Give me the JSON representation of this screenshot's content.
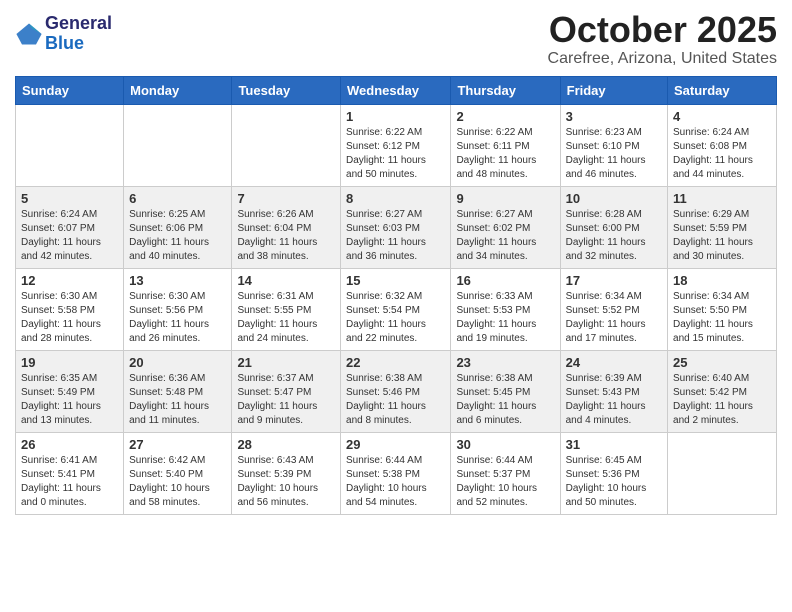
{
  "header": {
    "logo_general": "General",
    "logo_blue": "Blue",
    "title": "October 2025",
    "subtitle": "Carefree, Arizona, United States"
  },
  "weekdays": [
    "Sunday",
    "Monday",
    "Tuesday",
    "Wednesday",
    "Thursday",
    "Friday",
    "Saturday"
  ],
  "weeks": [
    [
      {
        "day": "",
        "info": ""
      },
      {
        "day": "",
        "info": ""
      },
      {
        "day": "",
        "info": ""
      },
      {
        "day": "1",
        "info": "Sunrise: 6:22 AM\nSunset: 6:12 PM\nDaylight: 11 hours\nand 50 minutes."
      },
      {
        "day": "2",
        "info": "Sunrise: 6:22 AM\nSunset: 6:11 PM\nDaylight: 11 hours\nand 48 minutes."
      },
      {
        "day": "3",
        "info": "Sunrise: 6:23 AM\nSunset: 6:10 PM\nDaylight: 11 hours\nand 46 minutes."
      },
      {
        "day": "4",
        "info": "Sunrise: 6:24 AM\nSunset: 6:08 PM\nDaylight: 11 hours\nand 44 minutes."
      }
    ],
    [
      {
        "day": "5",
        "info": "Sunrise: 6:24 AM\nSunset: 6:07 PM\nDaylight: 11 hours\nand 42 minutes."
      },
      {
        "day": "6",
        "info": "Sunrise: 6:25 AM\nSunset: 6:06 PM\nDaylight: 11 hours\nand 40 minutes."
      },
      {
        "day": "7",
        "info": "Sunrise: 6:26 AM\nSunset: 6:04 PM\nDaylight: 11 hours\nand 38 minutes."
      },
      {
        "day": "8",
        "info": "Sunrise: 6:27 AM\nSunset: 6:03 PM\nDaylight: 11 hours\nand 36 minutes."
      },
      {
        "day": "9",
        "info": "Sunrise: 6:27 AM\nSunset: 6:02 PM\nDaylight: 11 hours\nand 34 minutes."
      },
      {
        "day": "10",
        "info": "Sunrise: 6:28 AM\nSunset: 6:00 PM\nDaylight: 11 hours\nand 32 minutes."
      },
      {
        "day": "11",
        "info": "Sunrise: 6:29 AM\nSunset: 5:59 PM\nDaylight: 11 hours\nand 30 minutes."
      }
    ],
    [
      {
        "day": "12",
        "info": "Sunrise: 6:30 AM\nSunset: 5:58 PM\nDaylight: 11 hours\nand 28 minutes."
      },
      {
        "day": "13",
        "info": "Sunrise: 6:30 AM\nSunset: 5:56 PM\nDaylight: 11 hours\nand 26 minutes."
      },
      {
        "day": "14",
        "info": "Sunrise: 6:31 AM\nSunset: 5:55 PM\nDaylight: 11 hours\nand 24 minutes."
      },
      {
        "day": "15",
        "info": "Sunrise: 6:32 AM\nSunset: 5:54 PM\nDaylight: 11 hours\nand 22 minutes."
      },
      {
        "day": "16",
        "info": "Sunrise: 6:33 AM\nSunset: 5:53 PM\nDaylight: 11 hours\nand 19 minutes."
      },
      {
        "day": "17",
        "info": "Sunrise: 6:34 AM\nSunset: 5:52 PM\nDaylight: 11 hours\nand 17 minutes."
      },
      {
        "day": "18",
        "info": "Sunrise: 6:34 AM\nSunset: 5:50 PM\nDaylight: 11 hours\nand 15 minutes."
      }
    ],
    [
      {
        "day": "19",
        "info": "Sunrise: 6:35 AM\nSunset: 5:49 PM\nDaylight: 11 hours\nand 13 minutes."
      },
      {
        "day": "20",
        "info": "Sunrise: 6:36 AM\nSunset: 5:48 PM\nDaylight: 11 hours\nand 11 minutes."
      },
      {
        "day": "21",
        "info": "Sunrise: 6:37 AM\nSunset: 5:47 PM\nDaylight: 11 hours\nand 9 minutes."
      },
      {
        "day": "22",
        "info": "Sunrise: 6:38 AM\nSunset: 5:46 PM\nDaylight: 11 hours\nand 8 minutes."
      },
      {
        "day": "23",
        "info": "Sunrise: 6:38 AM\nSunset: 5:45 PM\nDaylight: 11 hours\nand 6 minutes."
      },
      {
        "day": "24",
        "info": "Sunrise: 6:39 AM\nSunset: 5:43 PM\nDaylight: 11 hours\nand 4 minutes."
      },
      {
        "day": "25",
        "info": "Sunrise: 6:40 AM\nSunset: 5:42 PM\nDaylight: 11 hours\nand 2 minutes."
      }
    ],
    [
      {
        "day": "26",
        "info": "Sunrise: 6:41 AM\nSunset: 5:41 PM\nDaylight: 11 hours\nand 0 minutes."
      },
      {
        "day": "27",
        "info": "Sunrise: 6:42 AM\nSunset: 5:40 PM\nDaylight: 10 hours\nand 58 minutes."
      },
      {
        "day": "28",
        "info": "Sunrise: 6:43 AM\nSunset: 5:39 PM\nDaylight: 10 hours\nand 56 minutes."
      },
      {
        "day": "29",
        "info": "Sunrise: 6:44 AM\nSunset: 5:38 PM\nDaylight: 10 hours\nand 54 minutes."
      },
      {
        "day": "30",
        "info": "Sunrise: 6:44 AM\nSunset: 5:37 PM\nDaylight: 10 hours\nand 52 minutes."
      },
      {
        "day": "31",
        "info": "Sunrise: 6:45 AM\nSunset: 5:36 PM\nDaylight: 10 hours\nand 50 minutes."
      },
      {
        "day": "",
        "info": ""
      }
    ]
  ]
}
